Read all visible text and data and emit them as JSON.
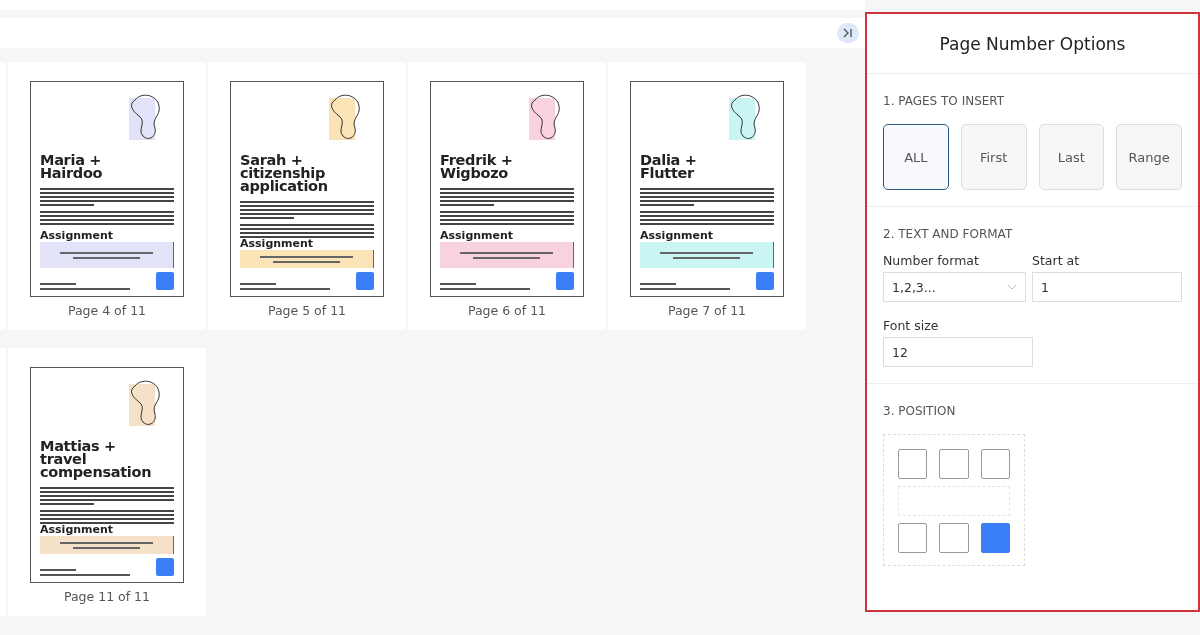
{
  "pages": [
    {
      "title": [
        "Maria +",
        "Hairdoo"
      ],
      "heading": "Assignment",
      "color": "#e2e3f8",
      "label": "Page 4 of 11"
    },
    {
      "title": [
        "Sarah +",
        "citizenship",
        "application"
      ],
      "heading": "Assignment",
      "color": "#fbe3b8",
      "label": "Page 5 of 11"
    },
    {
      "title": [
        "Fredrik +",
        "Wigbozo"
      ],
      "heading": "Assignment",
      "color": "#f9d2e2",
      "label": "Page 6 of 11"
    },
    {
      "title": [
        "Dalia +",
        "Flutter"
      ],
      "heading": "Assignment",
      "color": "#c9f6f3",
      "label": "Page 7 of 11"
    },
    {
      "title": [
        "Mattias +",
        "travel",
        "compensation"
      ],
      "heading": "Assignment",
      "color": "#f4e1c8",
      "label": "Page 11 of 11"
    }
  ],
  "panel": {
    "title": "Page Number Options",
    "pages_section": {
      "heading": "1. PAGES TO INSERT",
      "options": [
        {
          "label": "ALL",
          "selected": true
        },
        {
          "label": "First",
          "selected": false
        },
        {
          "label": "Last",
          "selected": false
        },
        {
          "label": "Range",
          "selected": false
        }
      ]
    },
    "format_section": {
      "heading": "2. TEXT AND FORMAT",
      "number_format": {
        "label": "Number format",
        "value": "1,2,3..."
      },
      "start_at": {
        "label": "Start at",
        "value": "1"
      },
      "font_size": {
        "label": "Font size",
        "value": "12"
      }
    },
    "position_section": {
      "heading": "3. POSITION",
      "top": [
        {
          "selected": false
        },
        {
          "selected": false
        },
        {
          "selected": false
        }
      ],
      "bottom": [
        {
          "selected": false
        },
        {
          "selected": false
        },
        {
          "selected": true
        }
      ]
    }
  }
}
